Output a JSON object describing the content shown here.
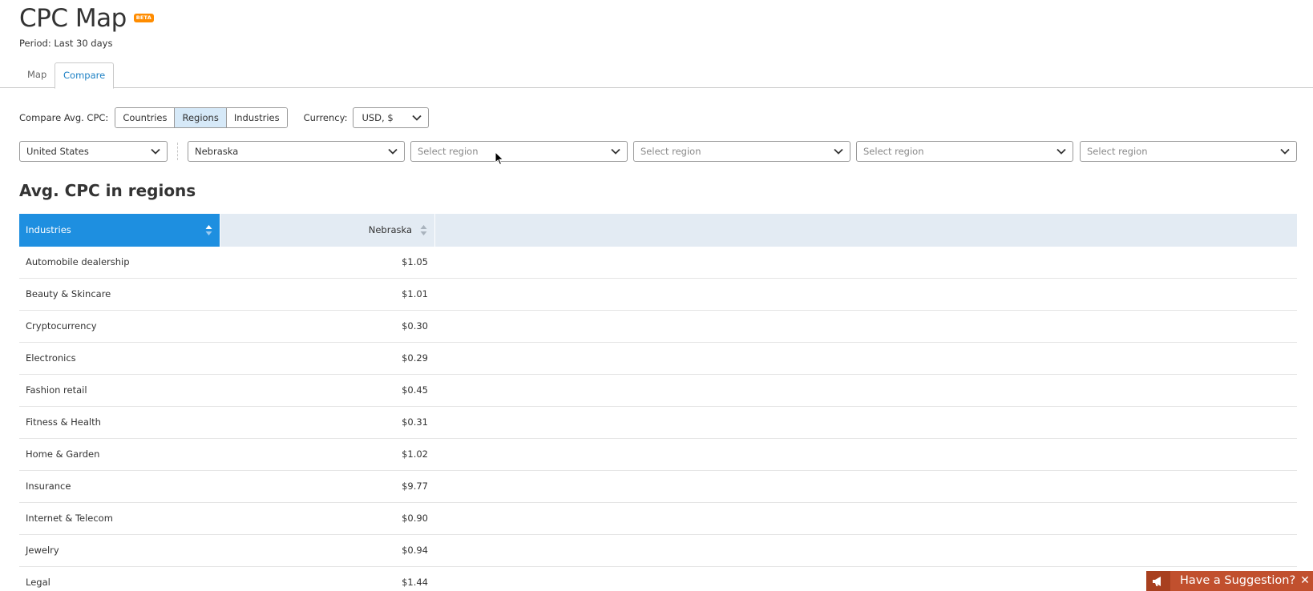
{
  "header": {
    "title": "CPC Map",
    "badge": "BETA",
    "period": "Period: Last 30 days"
  },
  "tabs": [
    {
      "label": "Map",
      "active": false
    },
    {
      "label": "Compare",
      "active": true
    }
  ],
  "compare": {
    "label": "Compare Avg. CPC:",
    "options": [
      "Countries",
      "Regions",
      "Industries"
    ],
    "selected": "Regions",
    "currency_label": "Currency:",
    "currency_value": "USD, $"
  },
  "selectors": {
    "country": "United States",
    "region1": "Nebraska",
    "placeholder": "Select region"
  },
  "section_title": "Avg. CPC in regions",
  "table": {
    "col_industries": "Industries",
    "col_region": "Nebraska",
    "rows": [
      {
        "industry": "Automobile dealership",
        "value": "$1.05"
      },
      {
        "industry": "Beauty & Skincare",
        "value": "$1.01"
      },
      {
        "industry": "Cryptocurrency",
        "value": "$0.30"
      },
      {
        "industry": "Electronics",
        "value": "$0.29"
      },
      {
        "industry": "Fashion retail",
        "value": "$0.45"
      },
      {
        "industry": "Fitness & Health",
        "value": "$0.31"
      },
      {
        "industry": "Home & Garden",
        "value": "$1.02"
      },
      {
        "industry": "Insurance",
        "value": "$9.77"
      },
      {
        "industry": "Internet & Telecom",
        "value": "$0.90"
      },
      {
        "industry": "Jewelry",
        "value": "$0.94"
      },
      {
        "industry": "Legal",
        "value": "$1.44"
      }
    ]
  },
  "suggestion": {
    "label": "Have a Suggestion?",
    "close": "✕"
  },
  "colors": {
    "accent": "#1e8fe0",
    "active_tab": "#1c80c4",
    "badge": "#ff8c00",
    "suggest": "#c1502e"
  }
}
